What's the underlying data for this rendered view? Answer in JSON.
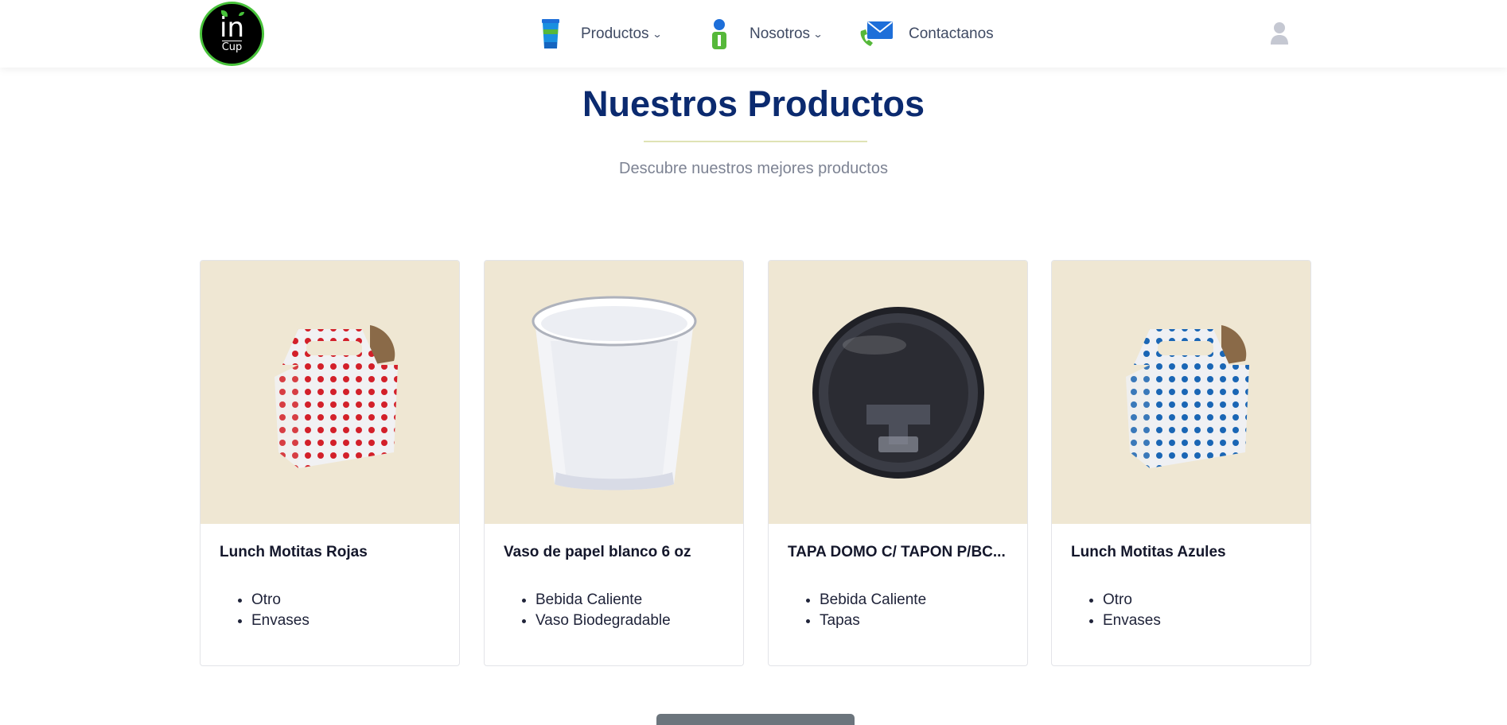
{
  "nav": {
    "logo_text": "in",
    "logo_subtext": "Cup",
    "products_label": "Productos",
    "about_label": "Nosotros",
    "contact_label": "Contactanos",
    "icons": [
      "cup-icon",
      "person-icon",
      "contact-mail-icon",
      "user-icon"
    ],
    "brand_green": "#48c23a"
  },
  "header": {
    "title": "Nuestros Productos",
    "subtitle": "Descubre nuestros mejores productos",
    "title_color": "#0b2a6f"
  },
  "products": [
    {
      "title": "Lunch Motitas Rojas",
      "tags": [
        "Otro",
        "Envases"
      ],
      "image": "red-dot-lunch-box"
    },
    {
      "title": "Vaso de papel blanco 6 oz",
      "tags": [
        "Bebida Caliente",
        "Vaso Biodegradable"
      ],
      "image": "white-paper-cup"
    },
    {
      "title": "TAPA DOMO C/ TAPON P/BC...",
      "tags": [
        "Bebida Caliente",
        "Tapas"
      ],
      "image": "black-dome-lid"
    },
    {
      "title": "Lunch Motitas Azules",
      "tags": [
        "Otro",
        "Envases"
      ],
      "image": "blue-dot-lunch-box"
    }
  ],
  "colors": {
    "card_image_bg": "#efe7d3",
    "button_gray": "#6c757d"
  }
}
